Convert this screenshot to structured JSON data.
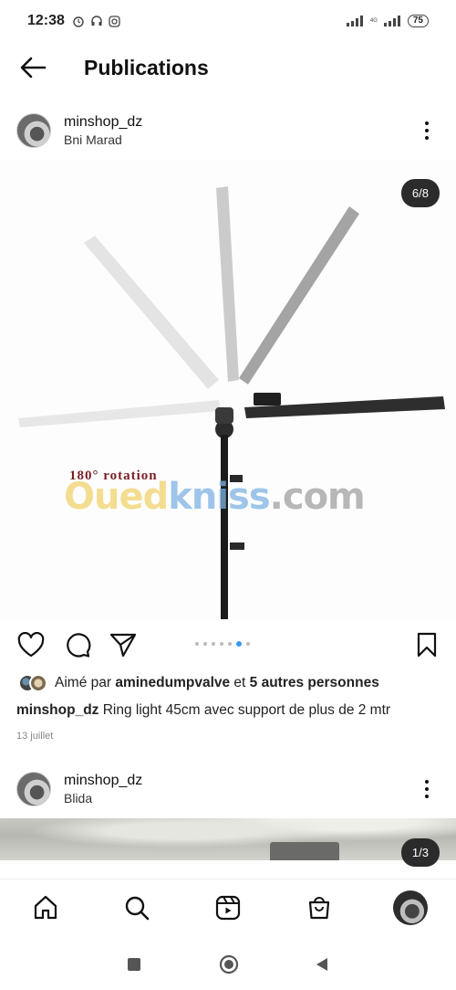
{
  "status_bar": {
    "time": "12:38",
    "battery": "75",
    "network_label": "4G"
  },
  "header": {
    "title": "Publications"
  },
  "post1": {
    "username": "minshop_dz",
    "location": "Bni Marad",
    "counter": "6/8",
    "image_text": {
      "rotation": "180°  rotation",
      "watermark_a": "Oued",
      "watermark_b": "kniss",
      "watermark_c": ".com"
    },
    "carousel": {
      "dots": 6,
      "active_index": 5
    },
    "likes": {
      "prefix": "Aimé par ",
      "user": "aminedumpvalve",
      "middle": " et ",
      "others": "5 autres personnes"
    },
    "caption": {
      "username": "minshop_dz",
      "text": " Ring light 45cm avec support de plus de 2 mtr"
    },
    "date": "13 juillet"
  },
  "post2": {
    "username": "minshop_dz",
    "location": "Blida",
    "counter": "1/3"
  },
  "icons": {
    "back": "arrow-left-icon",
    "more": "more-vertical-icon",
    "like": "heart-icon",
    "comment": "comment-icon",
    "share": "paper-plane-icon",
    "save": "bookmark-icon",
    "home": "home-icon",
    "search": "search-icon",
    "reels": "reels-icon",
    "shop": "shopping-bag-icon",
    "profile": "profile-avatar"
  },
  "colors": {
    "accent": "#3897f0",
    "text": "#111111",
    "muted": "#888888"
  }
}
